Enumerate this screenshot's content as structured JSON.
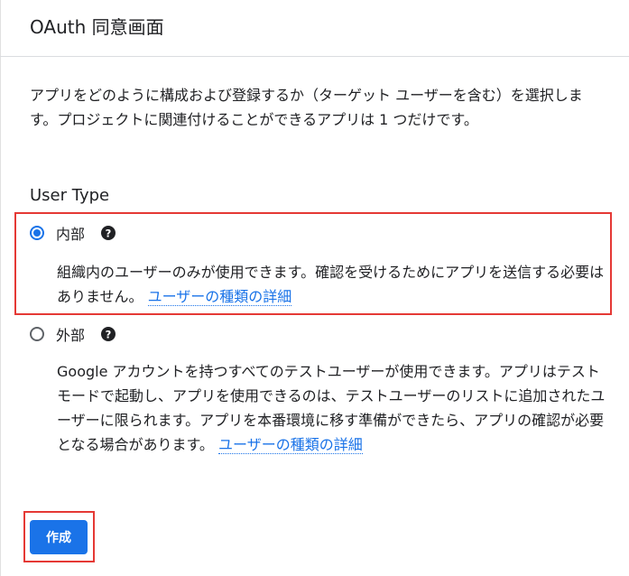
{
  "header": {
    "title": "OAuth 同意画面"
  },
  "intro": "アプリをどのように構成および登録するか（ターゲット ユーザーを含む）を選択します。プロジェクトに関連付けることができるアプリは 1 つだけです。",
  "user_type": {
    "heading": "User Type",
    "options": [
      {
        "label": "内部",
        "selected": true,
        "description": "組織内のユーザーのみが使用できます。確認を受けるためにアプリを送信する必要はありません。",
        "link_text": "ユーザーの種類の詳細"
      },
      {
        "label": "外部",
        "selected": false,
        "description": "Google アカウントを持つすべてのテストユーザーが使用できます。アプリはテストモードで起動し、アプリを使用できるのは、テストユーザーのリストに追加されたユーザーに限られます。アプリを本番環境に移す準備ができたら、アプリの確認が必要となる場合があります。",
        "link_text": "ユーザーの種類の詳細"
      }
    ]
  },
  "actions": {
    "create_label": "作成"
  },
  "colors": {
    "accent": "#1a73e8",
    "highlight": "#e53935"
  }
}
